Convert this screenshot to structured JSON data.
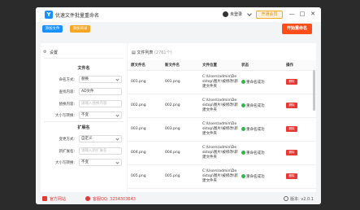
{
  "app": {
    "title": "优速文件批量重命名",
    "user": "未登录",
    "vip": "开通会员",
    "controls": [
      "—",
      "□",
      "✕"
    ]
  },
  "toolbar": {
    "add_files": "添加文件",
    "add_folder": "添加目录",
    "start": "开始重命名"
  },
  "settings": {
    "header": "设置",
    "filename_section": "文件名",
    "rename_mode_label": "命名方式:",
    "rename_mode_value": "替换",
    "find_label": "查找内容:",
    "find_value": "AD文件",
    "replace_label": "替换内容:",
    "replace_placeholder": "请输入替换内容",
    "case_label": "大小写转换:",
    "case_value": "不变",
    "ext_section": "扩展名",
    "ext_mode_label": "变更方式:",
    "ext_mode_value": "自定义",
    "new_ext_label": "新扩展名:",
    "new_ext_placeholder": "请输入新扩展名",
    "ext_case_label": "大小写转换:",
    "ext_case_value": "不变"
  },
  "filelist": {
    "header": "文件列表",
    "count": "(2761个)",
    "columns": [
      "原文件名",
      "新文件名",
      "文件位置",
      "状态",
      "操作"
    ],
    "rows": [
      {
        "orig": "001.png",
        "new": "001.png",
        "path": "C:\\Users\\admin\\Desktop\\图片\\被修改\\新建文件夹",
        "status": "重命名成功",
        "op": "删除"
      },
      {
        "orig": "002.png",
        "new": "002.png",
        "path": "C:\\Users\\admin\\Desktop\\图片\\被修改\\新建文件夹",
        "status": "重命名成功",
        "op": "删除"
      },
      {
        "orig": "003.png",
        "new": "003.png",
        "path": "C:\\Users\\admin\\Desktop\\图片\\被修改\\新建文件夹",
        "status": "重命名成功",
        "op": "删除"
      },
      {
        "orig": "004.png",
        "new": "004.png",
        "path": "C:\\Users\\admin\\Desktop\\图片\\被修改\\新建文件夹",
        "status": "重命名成功",
        "op": "删除"
      },
      {
        "orig": "005.png",
        "new": "005.png",
        "path": "C:\\Users\\admin\\Desktop\\图片\\被修改\\新建文件夹",
        "status": "重命名成功",
        "op": "删除"
      },
      {
        "orig": "006.png",
        "new": "006.png",
        "path": "C:\\Users\\admin\\Desktop\\图片\\被修改\\新建文件夹",
        "status": "重命名成功",
        "op": "删除"
      }
    ]
  },
  "statusbar": {
    "site": "官方网站",
    "qq": "客服QQ: 3234303643",
    "version": "版本: v2.0.1"
  }
}
